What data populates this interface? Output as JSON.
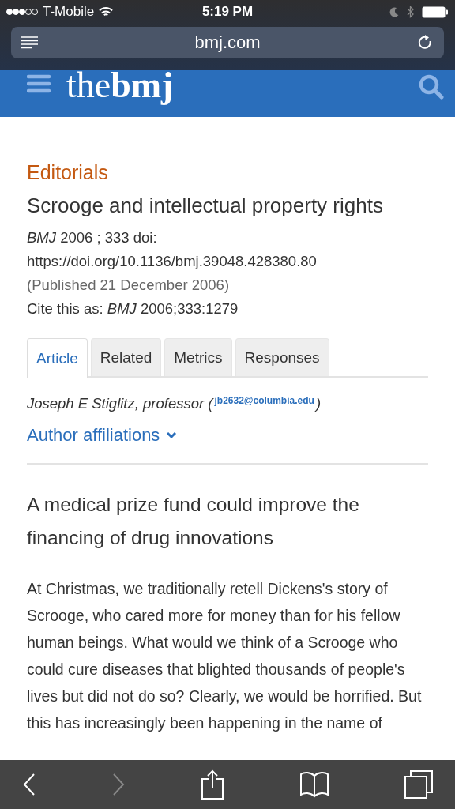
{
  "status_bar": {
    "carrier": "T-Mobile",
    "time": "5:19 PM"
  },
  "browser": {
    "url": "bmj.com"
  },
  "site_header": {
    "logo": "the**bmj**"
  },
  "article": {
    "section": "Editorials",
    "title": "Scrooge and intellectual property rights",
    "citation": "*BMJ*  2006 ; 333  doi:",
    "doi": "https://doi.org/10.1136/bmj.39048.428380.80",
    "published": "(Published 21 December 2006)",
    "cite_as": "Cite this as: *BMJ*  2006;333:1279",
    "tabs": [
      {
        "label": "Article",
        "selected": true
      },
      {
        "label": "Related",
        "selected": false
      },
      {
        "label": "Metrics",
        "selected": false
      },
      {
        "label": "Responses",
        "selected": false
      }
    ],
    "author": {
      "prefix": "Joseph E Stiglitz, professor (",
      "email": "jb2632@columbia.edu",
      "suffix": ")"
    },
    "affiliations": "Author affiliations",
    "standfirst": "A medical prize fund could improve the financing of drug innovations",
    "body": "At Christmas, we traditionally retell Dickens's story of Scrooge, who cared more for money than for his fellow human beings. What would we think of a Scrooge who could cure diseases that blighted thousands of people's lives but did not do so? Clearly, we would be horrified. But this has increasingly been happening in the name of"
  },
  "toolbar": [
    {
      "kind": "back",
      "disabled": false
    },
    {
      "kind": "forward",
      "disabled": true
    },
    {
      "kind": "share",
      "disabled": false
    },
    {
      "kind": "bookmarks",
      "disabled": false
    },
    {
      "kind": "tabs",
      "disabled": false
    }
  ]
}
